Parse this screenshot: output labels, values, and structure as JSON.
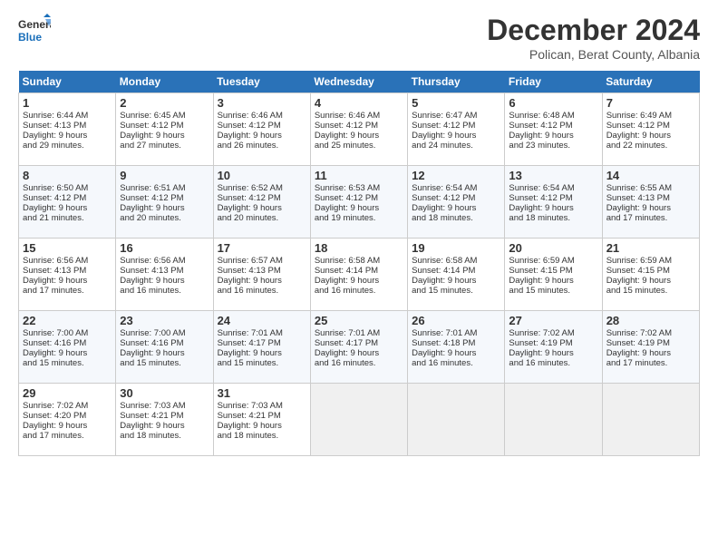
{
  "logo": {
    "line1": "General",
    "line2": "Blue"
  },
  "title": "December 2024",
  "subtitle": "Polican, Berat County, Albania",
  "days_header": [
    "Sunday",
    "Monday",
    "Tuesday",
    "Wednesday",
    "Thursday",
    "Friday",
    "Saturday"
  ],
  "weeks": [
    [
      {
        "day": 1,
        "info": "Sunrise: 6:44 AM\nSunset: 4:13 PM\nDaylight: 9 hours\nand 29 minutes."
      },
      {
        "day": 2,
        "info": "Sunrise: 6:45 AM\nSunset: 4:12 PM\nDaylight: 9 hours\nand 27 minutes."
      },
      {
        "day": 3,
        "info": "Sunrise: 6:46 AM\nSunset: 4:12 PM\nDaylight: 9 hours\nand 26 minutes."
      },
      {
        "day": 4,
        "info": "Sunrise: 6:46 AM\nSunset: 4:12 PM\nDaylight: 9 hours\nand 25 minutes."
      },
      {
        "day": 5,
        "info": "Sunrise: 6:47 AM\nSunset: 4:12 PM\nDaylight: 9 hours\nand 24 minutes."
      },
      {
        "day": 6,
        "info": "Sunrise: 6:48 AM\nSunset: 4:12 PM\nDaylight: 9 hours\nand 23 minutes."
      },
      {
        "day": 7,
        "info": "Sunrise: 6:49 AM\nSunset: 4:12 PM\nDaylight: 9 hours\nand 22 minutes."
      }
    ],
    [
      {
        "day": 8,
        "info": "Sunrise: 6:50 AM\nSunset: 4:12 PM\nDaylight: 9 hours\nand 21 minutes."
      },
      {
        "day": 9,
        "info": "Sunrise: 6:51 AM\nSunset: 4:12 PM\nDaylight: 9 hours\nand 20 minutes."
      },
      {
        "day": 10,
        "info": "Sunrise: 6:52 AM\nSunset: 4:12 PM\nDaylight: 9 hours\nand 20 minutes."
      },
      {
        "day": 11,
        "info": "Sunrise: 6:53 AM\nSunset: 4:12 PM\nDaylight: 9 hours\nand 19 minutes."
      },
      {
        "day": 12,
        "info": "Sunrise: 6:54 AM\nSunset: 4:12 PM\nDaylight: 9 hours\nand 18 minutes."
      },
      {
        "day": 13,
        "info": "Sunrise: 6:54 AM\nSunset: 4:12 PM\nDaylight: 9 hours\nand 18 minutes."
      },
      {
        "day": 14,
        "info": "Sunrise: 6:55 AM\nSunset: 4:13 PM\nDaylight: 9 hours\nand 17 minutes."
      }
    ],
    [
      {
        "day": 15,
        "info": "Sunrise: 6:56 AM\nSunset: 4:13 PM\nDaylight: 9 hours\nand 17 minutes."
      },
      {
        "day": 16,
        "info": "Sunrise: 6:56 AM\nSunset: 4:13 PM\nDaylight: 9 hours\nand 16 minutes."
      },
      {
        "day": 17,
        "info": "Sunrise: 6:57 AM\nSunset: 4:13 PM\nDaylight: 9 hours\nand 16 minutes."
      },
      {
        "day": 18,
        "info": "Sunrise: 6:58 AM\nSunset: 4:14 PM\nDaylight: 9 hours\nand 16 minutes."
      },
      {
        "day": 19,
        "info": "Sunrise: 6:58 AM\nSunset: 4:14 PM\nDaylight: 9 hours\nand 15 minutes."
      },
      {
        "day": 20,
        "info": "Sunrise: 6:59 AM\nSunset: 4:15 PM\nDaylight: 9 hours\nand 15 minutes."
      },
      {
        "day": 21,
        "info": "Sunrise: 6:59 AM\nSunset: 4:15 PM\nDaylight: 9 hours\nand 15 minutes."
      }
    ],
    [
      {
        "day": 22,
        "info": "Sunrise: 7:00 AM\nSunset: 4:16 PM\nDaylight: 9 hours\nand 15 minutes."
      },
      {
        "day": 23,
        "info": "Sunrise: 7:00 AM\nSunset: 4:16 PM\nDaylight: 9 hours\nand 15 minutes."
      },
      {
        "day": 24,
        "info": "Sunrise: 7:01 AM\nSunset: 4:17 PM\nDaylight: 9 hours\nand 15 minutes."
      },
      {
        "day": 25,
        "info": "Sunrise: 7:01 AM\nSunset: 4:17 PM\nDaylight: 9 hours\nand 16 minutes."
      },
      {
        "day": 26,
        "info": "Sunrise: 7:01 AM\nSunset: 4:18 PM\nDaylight: 9 hours\nand 16 minutes."
      },
      {
        "day": 27,
        "info": "Sunrise: 7:02 AM\nSunset: 4:19 PM\nDaylight: 9 hours\nand 16 minutes."
      },
      {
        "day": 28,
        "info": "Sunrise: 7:02 AM\nSunset: 4:19 PM\nDaylight: 9 hours\nand 17 minutes."
      }
    ],
    [
      {
        "day": 29,
        "info": "Sunrise: 7:02 AM\nSunset: 4:20 PM\nDaylight: 9 hours\nand 17 minutes."
      },
      {
        "day": 30,
        "info": "Sunrise: 7:03 AM\nSunset: 4:21 PM\nDaylight: 9 hours\nand 18 minutes."
      },
      {
        "day": 31,
        "info": "Sunrise: 7:03 AM\nSunset: 4:21 PM\nDaylight: 9 hours\nand 18 minutes."
      },
      null,
      null,
      null,
      null
    ]
  ]
}
